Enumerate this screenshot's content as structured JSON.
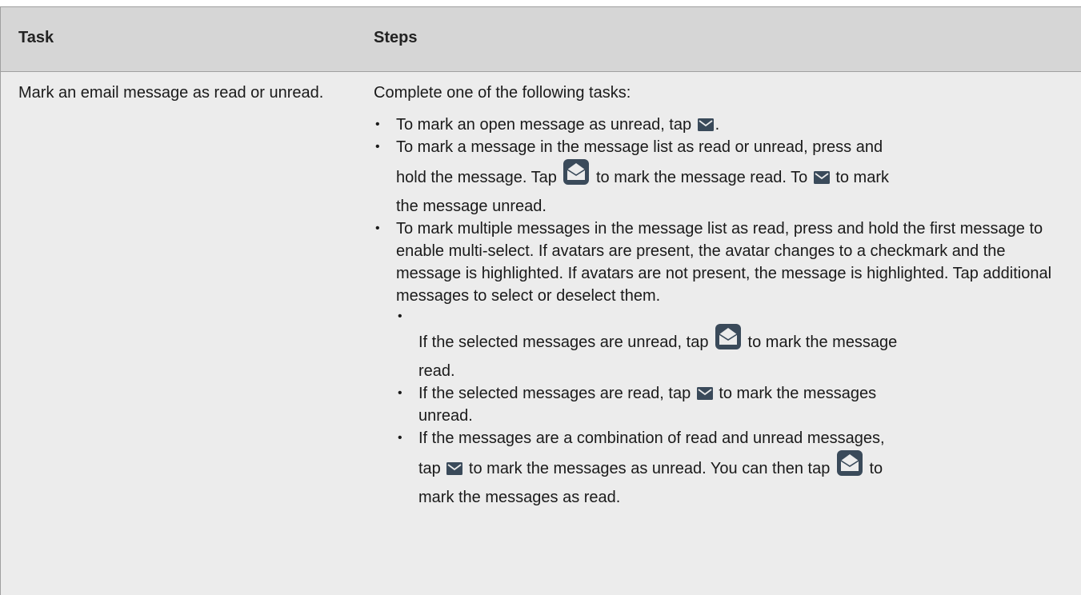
{
  "header": {
    "task_label": "Task",
    "steps_label": "Steps"
  },
  "row": {
    "task": "Mark an email message as read or unread.",
    "intro": "Complete one of the following tasks:",
    "item1": {
      "before": "To mark an open message as unread, tap ",
      "after": "."
    },
    "item2": {
      "line1": "To mark a message in the message list as read or unread, press and",
      "seg1": "hold the message. Tap ",
      "seg2": " to mark the message read. To ",
      "seg3": " to mark",
      "line3": "the message unread."
    },
    "item3": {
      "text": "To mark multiple messages in the message list as read, press and hold the first message to enable multi-select. If avatars are present, the avatar changes to a checkmark and the message is highlighted. If avatars are not present, the message is highlighted. Tap additional messages to select or deselect them."
    },
    "sub1": {
      "before": "If the selected messages are unread, tap ",
      "after": " to mark the message",
      "line2": "read."
    },
    "sub2": {
      "before": "If the selected messages are read, tap ",
      "after": " to mark the messages",
      "line2": "unread."
    },
    "sub3": {
      "line1": "If the messages are a combination of read and unread messages,",
      "seg1": "tap ",
      "seg2": " to mark the messages as unread. You can then tap ",
      "seg3": " to",
      "line3": "mark the messages as read."
    }
  },
  "icons": {
    "envelope": "envelope-icon",
    "open_envelope": "open-envelope-icon"
  },
  "colors": {
    "header_bg": "#d6d6d6",
    "row_bg": "#ececec",
    "icon": "#3a4a5a"
  }
}
